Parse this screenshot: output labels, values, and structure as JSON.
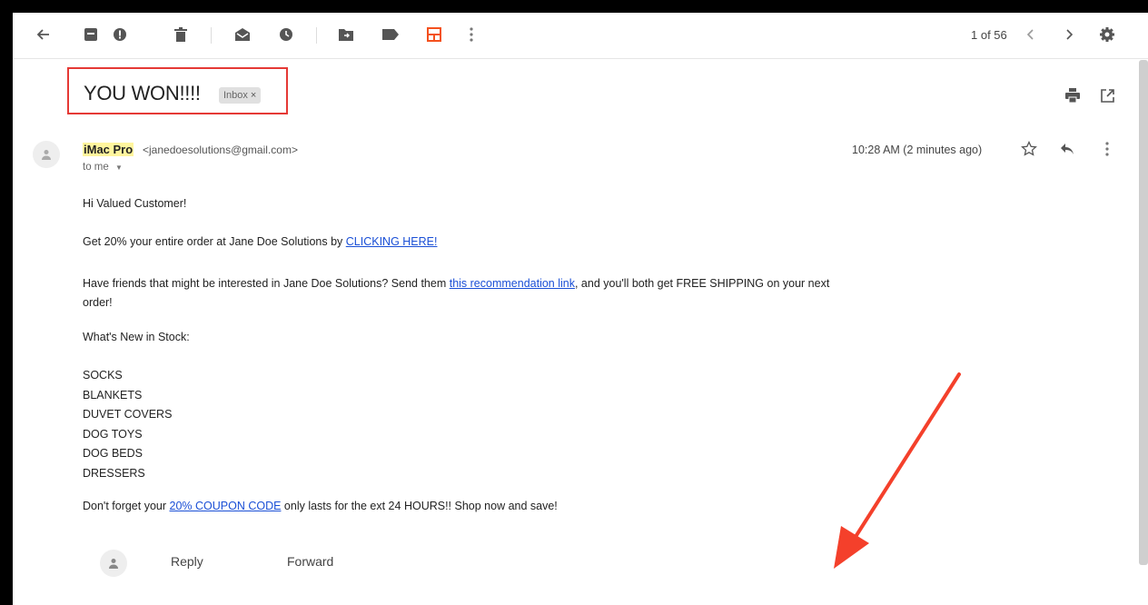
{
  "toolbar": {
    "icons": [
      "back-arrow-icon",
      "archive-icon",
      "report-spam-icon",
      "delete-icon",
      "mark-unread-icon",
      "snooze-icon",
      "move-to-icon",
      "label-icon",
      "layout-icon",
      "more-vertical-icon"
    ],
    "pager_text": "1 of 56"
  },
  "email": {
    "subject": "YOU WON!!!!",
    "label": "Inbox",
    "sender_name": "iMac Pro",
    "sender_email": "<janedoesolutions@gmail.com>",
    "to_line": "to me",
    "timestamp": "10:28 AM (2 minutes ago)",
    "greeting": "Hi Valued Customer!",
    "line1_prefix": "Get 20% your entire order at Jane Doe Solutions by ",
    "line1_link": "CLICKING HERE!",
    "line2_prefix": "Have friends that might be interested in Jane Doe Solutions? Send them ",
    "line2_link": "this recommendation link",
    "line2_suffix": ", and you'll both get FREE SHIPPING on your next",
    "line2_cont": "order!",
    "whats_new": "What's New in Stock:",
    "stock_items": [
      "SOCKS",
      "BLANKETS",
      "DUVET COVERS",
      "DOG TOYS",
      "DOG BEDS",
      "DRESSERS"
    ],
    "line3_prefix": "Don't forget your ",
    "line3_link": "20% COUPON CODE",
    "line3_suffix": " only lasts for the ext 24 HOURS!! Shop now and save!"
  },
  "actions": {
    "reply": "Reply",
    "forward": "Forward"
  },
  "colors": {
    "highlight_box": "#e53935",
    "link": "#1a4fd6",
    "arrow": "#f4402b",
    "sender_highlight": "#fff59d"
  }
}
